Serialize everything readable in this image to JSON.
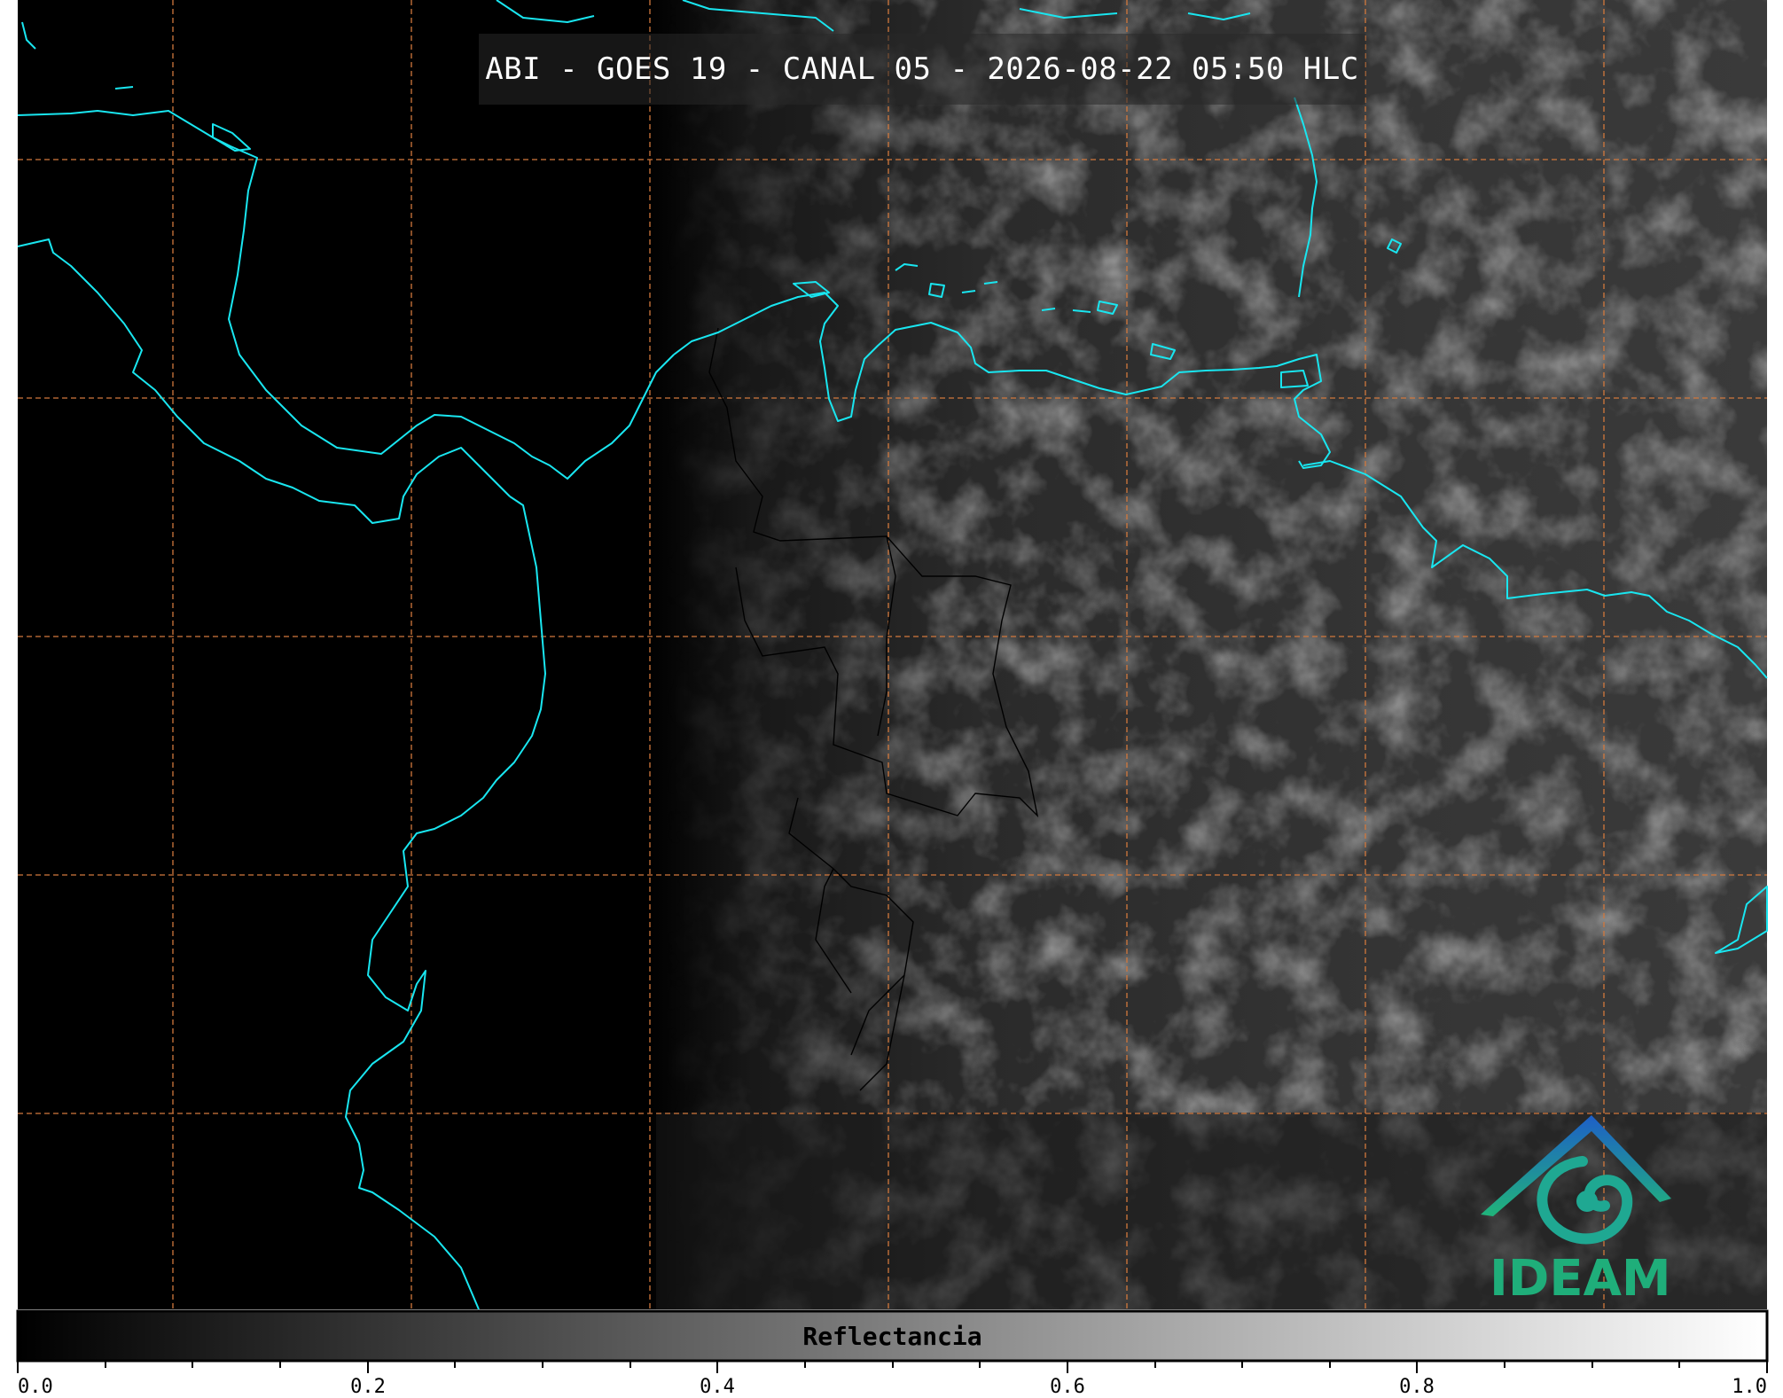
{
  "title": "ABI - GOES 19 - CANAL 05 - 2026-08-22 05:50 HLC",
  "colorbar": {
    "label": "Reflectancia",
    "ticks": [
      "0.0",
      "0.2",
      "0.4",
      "0.6",
      "0.8",
      "1.0"
    ],
    "range": [
      0.0,
      1.0
    ],
    "colormap": [
      "#000000",
      "#ffffff"
    ]
  },
  "logo": {
    "text": "IDEAM",
    "icon": "ideam-logo-icon"
  },
  "colors": {
    "coastline": "#19e6f0",
    "gridlines": "#d2783c",
    "borders": "#000000",
    "title_bg": "#282828"
  }
}
